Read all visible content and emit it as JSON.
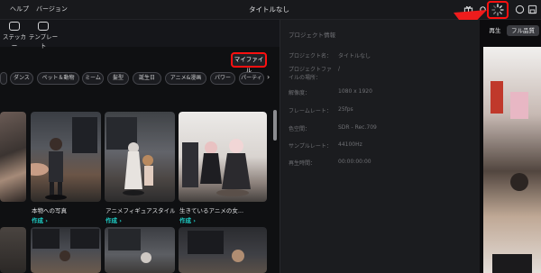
{
  "menu": {
    "help": "ヘルプ",
    "version": "バージョン"
  },
  "window": {
    "title": "タイトルなし"
  },
  "toolbar": {
    "sticker": "ステッカー",
    "template": "テンプレート"
  },
  "my_file_button": "マイファイル",
  "categories": [
    "ダンス",
    "ペット＆動物",
    "ミーム",
    "髪型",
    "誕生日",
    "アニメ&漫画",
    "パワー",
    "パーティ"
  ],
  "cards_row1": [
    {
      "caption": "",
      "action": ""
    },
    {
      "caption": "本物への写真",
      "action": "作成 ›"
    },
    {
      "caption": "アニメフィギュアスタイル",
      "action": "作成 ›"
    },
    {
      "caption": "生きているアニメの女...",
      "action": "作成 ›"
    }
  ],
  "info_panel": {
    "header": "プロジェクト情報",
    "rows": [
      {
        "label": "プロジェクト名：",
        "value": "タイトルなし"
      },
      {
        "label": "プロジェクトファイルの場所：",
        "value": "/"
      },
      {
        "label": "解像度：",
        "value": "1080 x 1920"
      },
      {
        "label": "フレームレート：",
        "value": "25fps"
      },
      {
        "label": "色空間：",
        "value": "SDR - Rec.709"
      },
      {
        "label": "サンプルレート：",
        "value": "44100Hz"
      },
      {
        "label": "再生時間：",
        "value": "00:00:00:00"
      }
    ]
  },
  "preview": {
    "tab_play": "再生",
    "tab_quality": "フル品質"
  },
  "colors": {
    "accent_teal": "#1ed1c9",
    "highlight_red": "#ff1010",
    "arrow_red": "#ee1c1c"
  }
}
